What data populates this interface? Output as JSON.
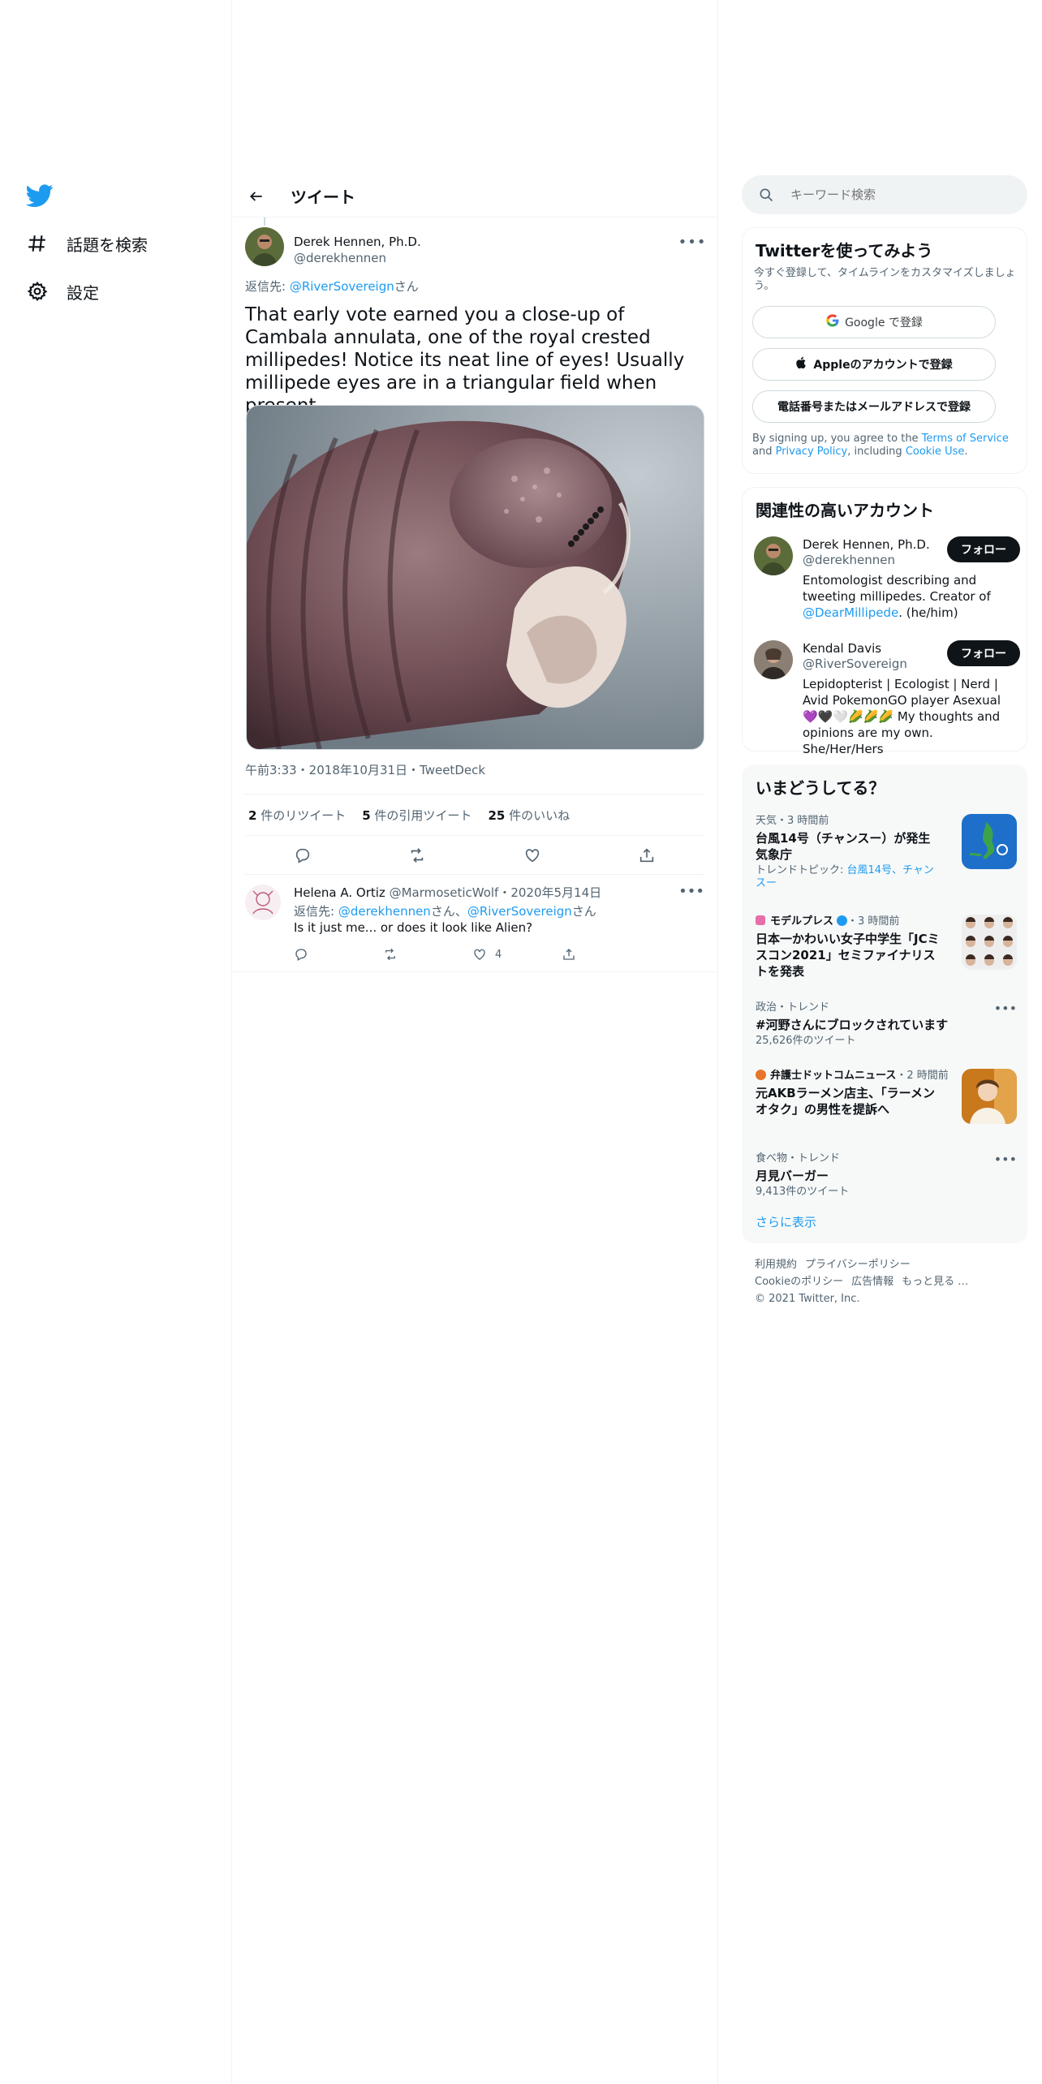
{
  "nav": {
    "explore_label": "話題を検索",
    "settings_label": "設定"
  },
  "header": {
    "title": "ツイート"
  },
  "tweet": {
    "author_name": "Derek Hennen, Ph.D.",
    "author_handle": "@derekhennen",
    "reply_prefix": "返信先: ",
    "reply_to": "@RiverSovereign",
    "reply_suffix": "さん",
    "text": "That early vote earned you a close-up of Cambala annulata, one of the royal crested millipedes! Notice its neat line of eyes! Usually millipede eyes are in a triangular field when present.",
    "image_icon": "millipede-photo",
    "meta": "午前3:33・2018年10月31日・TweetDeck",
    "retweets_count": "2",
    "retweets_label": " 件のリツイート",
    "quotes_count": "5",
    "quotes_label": " 件の引用ツイート",
    "likes_count": "25",
    "likes_label": " 件のいいね"
  },
  "reply": {
    "name": "Helena A. Ortiz",
    "handle": "@MarmoseticWolf",
    "date": "・2020年5月14日",
    "reply_prefix": "返信先: ",
    "mention1": "@derekhennen",
    "sep": "さん、",
    "mention2": "@RiverSovereign",
    "suffix": "さん",
    "text": "Is it just me... or does it look like Alien?",
    "likes": "4"
  },
  "search": {
    "placeholder": "キーワード検索"
  },
  "signup": {
    "title": "Twitterを使ってみよう",
    "subtitle": "今すぐ登録して、タイムラインをカスタマイズしましょう。",
    "google_label": "Google で登録",
    "apple_label": "Appleのアカウントで登録",
    "phone_label": "電話番号またはメールアドレスで登録",
    "legal_prefix": "By signing up, you agree to the ",
    "terms": "Terms of Service",
    "and": " and ",
    "privacy": "Privacy Policy",
    "including": ", including ",
    "cookie": "Cookie Use",
    "period": "."
  },
  "relevant": {
    "title": "関連性の高いアカウント",
    "follow_label": "フォロー",
    "users": [
      {
        "name": "Derek Hennen, Ph.D.",
        "handle": "@derekhennen",
        "bio_prefix": "Entomologist describing and tweeting millipedes. Creator of ",
        "bio_link": "@DearMillipede",
        "bio_suffix": ". (he/him)"
      },
      {
        "name": "Kendal Davis",
        "handle": "@RiverSovereign",
        "bio": "Lepidopterist | Ecologist | Nerd | Avid PokemonGO player Asexual💜🖤🤍🌽🌽🌽 My thoughts and opinions are my own. She/Her/Hers"
      }
    ]
  },
  "trends": {
    "title": "いまどうしてる？",
    "items": [
      {
        "meta": "天気・3 時間前",
        "title": "台風14号（チャンスー）が発生 気象庁",
        "sub_prefix": "トレンドトピック: ",
        "sub_link": "台風14号、チャンスー",
        "thumb": "weather-map"
      },
      {
        "meta_source": "モデルプレス",
        "meta_time": "・3 時間前",
        "title": "日本一かわいい女子中学生「JCミスコン2021」セミファイナリストを発表",
        "thumb": "contestants-grid"
      },
      {
        "meta": "政治・トレンド",
        "title": "#河野さんにブロックされています",
        "sub": "25,626件のツイート"
      },
      {
        "meta_source": "弁護士ドットコムニュース",
        "meta_time": "・2 時間前",
        "title": "元AKBラーメン店主、「ラーメンオタク」の男性を提訴へ",
        "thumb": "ramen-owner-photo"
      },
      {
        "meta": "食べ物・トレンド",
        "title": "月見バーガー",
        "sub": "9,413件のツイート"
      }
    ],
    "show_more": "さらに表示"
  },
  "footer": {
    "terms": "利用規約",
    "privacy": "プライバシーポリシー",
    "cookie": "Cookieのポリシー",
    "ads": "広告情報",
    "more": "もっと見る …",
    "copyright": "© 2021 Twitter, Inc."
  },
  "colors": {
    "accent": "#1d9bf0",
    "text": "#0f1419",
    "muted": "#536471",
    "border": "#eff3f4"
  }
}
